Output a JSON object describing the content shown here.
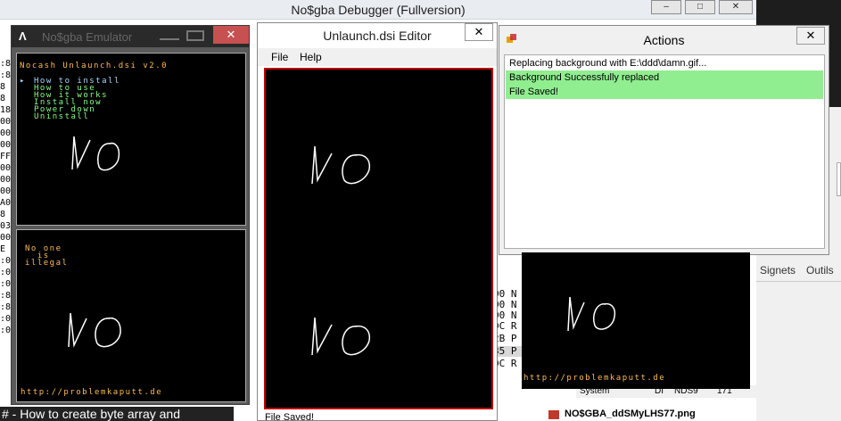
{
  "background_window": {
    "title": "No$gba Debugger (Fullversion)",
    "title_buttons": [
      "–",
      "□",
      "✕"
    ],
    "left_strip": [
      ":8",
      ":8",
      "8",
      "8",
      "18",
      "00",
      "00",
      "00",
      "FF",
      "00",
      "00",
      "00",
      "A0",
      "8",
      "03",
      "00",
      "E",
      ":00",
      ":0",
      ":0",
      ":8",
      ":8",
      ":0",
      ":0"
    ],
    "caption": "# - How to create byte array and",
    "tabs": [
      "Signets",
      "Outils"
    ],
    "disasm_lines": [
      "00 N",
      "00 N",
      "00 N",
      "DC R",
      "2B P",
      "35 P",
      "DC R"
    ],
    "status_cells": [
      "System",
      "DI",
      "NDS9",
      "171"
    ],
    "file_name": "NO$GBA_ddSMyLHS77.png"
  },
  "emulator_window": {
    "logo": "Λ",
    "ghost_title": "No$gba Emulator",
    "close_label": "✕",
    "top_screen": {
      "header": "Nocash Unlaunch.dsi v2.0",
      "menu_cursor": "▸",
      "menu_items": [
        "How to install",
        "How to use",
        "How it works",
        "Install now",
        "Power down",
        "Uninstall"
      ],
      "drawing": "NO"
    },
    "bottom_screen": {
      "message_lines": [
        "No one",
        "  is",
        "illegal"
      ],
      "drawing": "NO",
      "url": "http://problemkaputt.de"
    }
  },
  "editor_window": {
    "title": "Unlaunch.dsi Editor",
    "close_label": "✕",
    "menu": [
      "File",
      "Help"
    ],
    "status": "File Saved!"
  },
  "actions_window": {
    "title": "Actions",
    "close_label": "✕",
    "log": [
      {
        "text": "Replacing background with E:\\ddd\\damn.gif...",
        "status": "info"
      },
      {
        "text": "Background Successfully replaced",
        "status": "success"
      },
      {
        "text": "File Saved!",
        "status": "success"
      }
    ]
  },
  "preview_screen": {
    "url": "http://problemkaputt.de"
  },
  "colors": {
    "success_row": "#90ee90",
    "close_red": "#c75050",
    "screen_bg": "#000000",
    "nds_orange": "#ffbb55",
    "nds_green": "#88ff88",
    "editor_border": "#c00000"
  }
}
